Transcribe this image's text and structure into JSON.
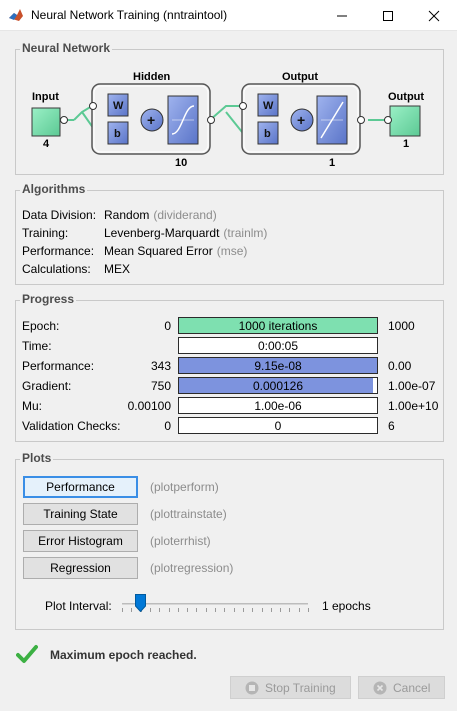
{
  "window": {
    "title": "Neural Network Training (nntraintool)"
  },
  "network": {
    "section_title": "Neural Network",
    "input_label": "Input",
    "input_size": "4",
    "hidden_label": "Hidden",
    "hidden_size": "10",
    "output_layer_label": "Output",
    "output_layer_size": "1",
    "output_label": "Output",
    "output_size": "1",
    "weight_symbol": "W",
    "bias_symbol": "b",
    "sum_symbol": "+"
  },
  "algorithms": {
    "section_title": "Algorithms",
    "rows": [
      {
        "label": "Data Division:",
        "value": "Random",
        "func": "(dividerand)"
      },
      {
        "label": "Training:",
        "value": "Levenberg-Marquardt",
        "func": "(trainlm)"
      },
      {
        "label": "Performance:",
        "value": "Mean Squared Error",
        "func": "(mse)"
      },
      {
        "label": "Calculations:",
        "value": "MEX",
        "func": ""
      }
    ]
  },
  "progress": {
    "section_title": "Progress",
    "rows": [
      {
        "label": "Epoch:",
        "start": "0",
        "value": "1000 iterations",
        "end": "1000",
        "fill": 1.0
      },
      {
        "label": "Time:",
        "start": "",
        "value": "0:00:05",
        "end": "",
        "fill": 0.0
      },
      {
        "label": "Performance:",
        "start": "343",
        "value": "9.15e-08",
        "end": "0.00",
        "fill": 1.0
      },
      {
        "label": "Gradient:",
        "start": "750",
        "value": "0.000126",
        "end": "1.00e-07",
        "fill": 0.98
      },
      {
        "label": "Mu:",
        "start": "0.00100",
        "value": "1.00e-06",
        "end": "1.00e+10",
        "fill": 0.0
      },
      {
        "label": "Validation Checks:",
        "start": "0",
        "value": "0",
        "end": "6",
        "fill": 0.0
      }
    ]
  },
  "plots": {
    "section_title": "Plots",
    "buttons": [
      {
        "label": "Performance",
        "func": "(plotperform)"
      },
      {
        "label": "Training State",
        "func": "(plottrainstate)"
      },
      {
        "label": "Error Histogram",
        "func": "(ploterrhist)"
      },
      {
        "label": "Regression",
        "func": "(plotregression)"
      }
    ],
    "interval_label": "Plot Interval:",
    "interval_value": "1 epochs",
    "interval_fraction": 0.0
  },
  "status": {
    "message": "Maximum epoch reached.",
    "icon": "checkmark-icon"
  },
  "buttons": {
    "stop_label": "Stop Training",
    "cancel_label": "Cancel"
  },
  "colors": {
    "epoch_fill": "#7ee0b0",
    "blue_fill": "#7d93de",
    "accent_focus": "#3a8ee6",
    "block_green": "#7de0b0",
    "status_green": "#3cb043"
  }
}
